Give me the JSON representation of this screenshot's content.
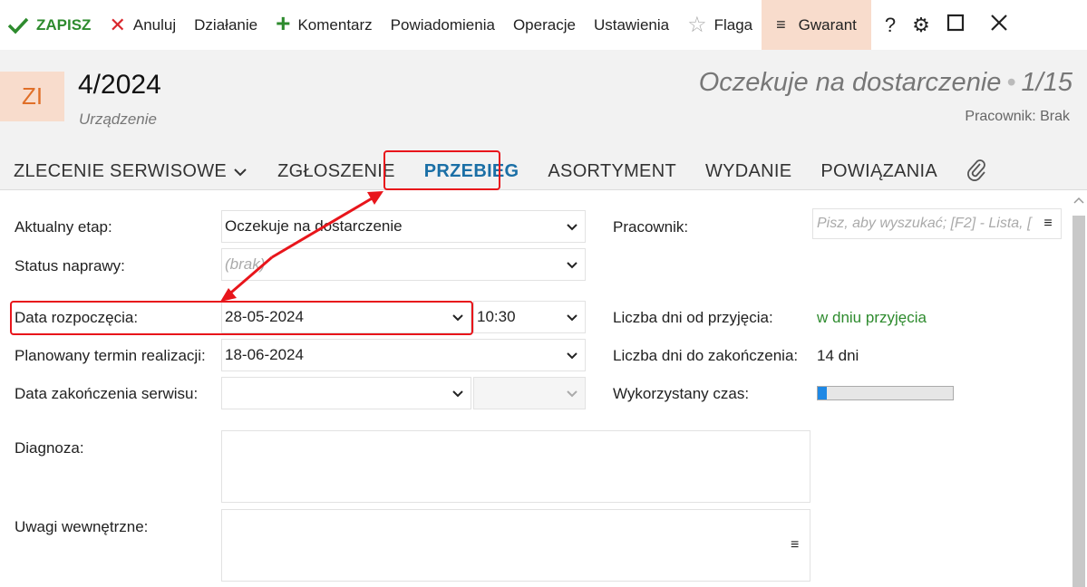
{
  "toolbar": {
    "save": "ZAPISZ",
    "cancel": "Anuluj",
    "action": "Działanie",
    "comment": "Komentarz",
    "notifications": "Powiadomienia",
    "operations": "Operacje",
    "settings": "Ustawienia",
    "flag": "Flaga",
    "warranty": "Gwarant",
    "help": "?"
  },
  "header": {
    "badge": "ZI",
    "number": "4/2024",
    "subtitle": "Urządzenie",
    "status": "Oczekuje na dostarczenie",
    "position": "1/15",
    "worker": "Pracownik: Brak"
  },
  "tabs": [
    {
      "label": "ZLECENIE SERWISOWE"
    },
    {
      "label": "ZGŁOSZENIE"
    },
    {
      "label": "PRZEBIEG",
      "active": true
    },
    {
      "label": "ASORTYMENT"
    },
    {
      "label": "WYDANIE"
    },
    {
      "label": "POWIĄZANIA"
    }
  ],
  "form": {
    "current_stage_label": "Aktualny etap:",
    "current_stage_value": "Oczekuje na dostarczenie",
    "repair_status_label": "Status naprawy:",
    "repair_status_placeholder": "(brak)",
    "start_date_label": "Data rozpoczęcia:",
    "start_date_value": "28-05-2024",
    "start_time_value": "10:30",
    "planned_date_label": "Planowany termin realizacji:",
    "planned_date_value": "18-06-2024",
    "end_date_label": "Data zakończenia serwisu:",
    "end_date_value": "",
    "diagnosis_label": "Diagnoza:",
    "internal_notes_label": "Uwagi wewnętrzne:",
    "worker_label": "Pracownik:",
    "worker_placeholder": "Pisz, aby wyszukać; [F2] - Lista, [",
    "days_since_label": "Liczba dni od przyjęcia:",
    "days_since_value": "w dniu przyjęcia",
    "days_to_end_label": "Liczba dni do zakończenia:",
    "days_to_end_value": "14 dni",
    "used_time_label": "Wykorzystany czas:",
    "used_time_fraction": 0.07
  },
  "colors": {
    "accent": "#1a6fa6",
    "save_green": "#2e8b2e",
    "cancel_red": "#d9262c",
    "badge_bg": "#f8dccc",
    "badge_text": "#e06f28",
    "annotation_red": "#e8151b",
    "progress_fill": "#1e88e5"
  },
  "icons": {
    "save": "check-icon",
    "cancel": "x-icon",
    "comment": "plus-icon",
    "flag": "star-icon",
    "warranty": "menu-icon",
    "help": "question-icon",
    "settings": "gear-icon",
    "maximize": "square-icon",
    "close": "close-icon",
    "attachment": "paperclip-icon"
  }
}
